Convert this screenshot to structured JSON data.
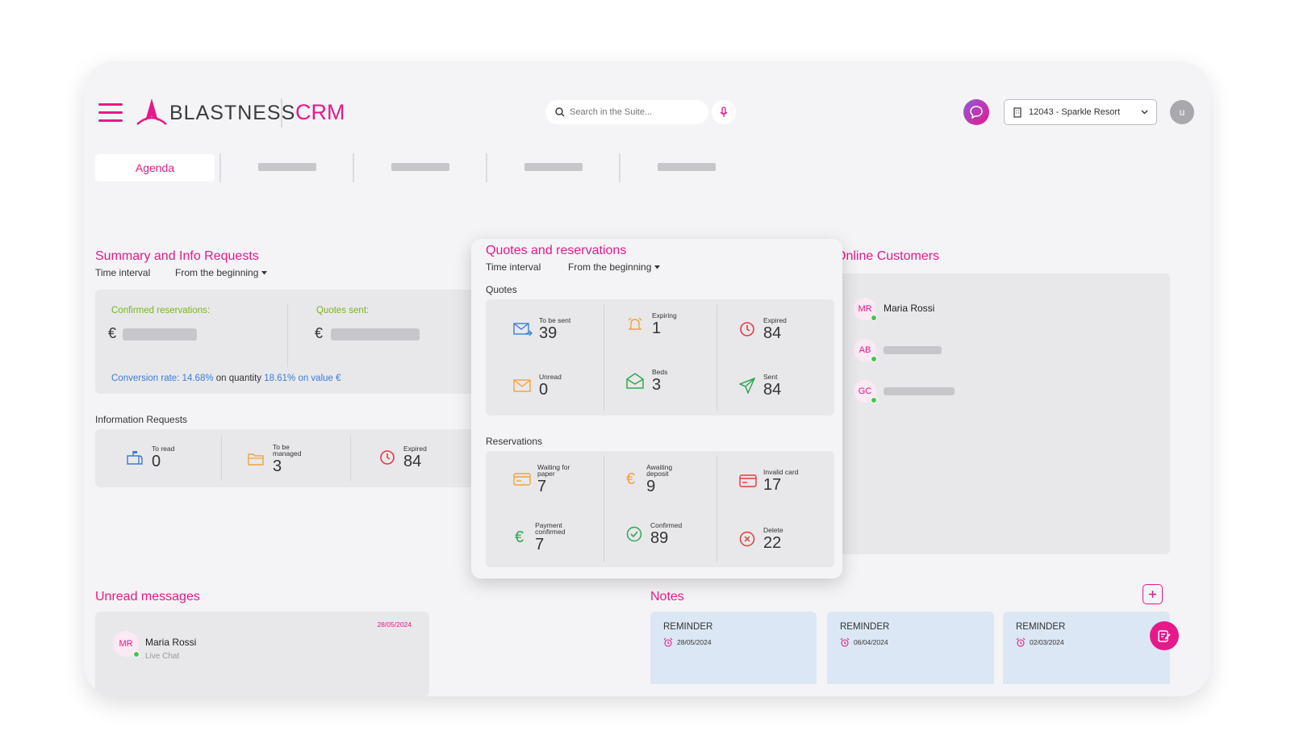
{
  "header": {
    "brand": "BLASTNESS",
    "product": "CRM",
    "search_placeholder": "Search in the Suite...",
    "property": "12043 - Sparkle Resort",
    "user_initial": "u"
  },
  "tabs": {
    "active": "Agenda"
  },
  "summary": {
    "title": "Summary and Info Requests",
    "interval_label": "Time interval",
    "interval_value": "From the beginning",
    "confirmed_label": "Confirmed reservations:",
    "quotes_sent_label": "Quotes sent:",
    "currency": "€",
    "conversion_prefix": "Conversion rate: 14.68%",
    "conversion_mid": "on quantity",
    "conversion_suffix": "18.61% on value €"
  },
  "info_requests": {
    "title": "Information Requests",
    "items": [
      {
        "label": "To read",
        "value": "0"
      },
      {
        "label": "To be managed",
        "value": "3"
      },
      {
        "label": "Expired",
        "value": "84"
      }
    ]
  },
  "quotes_reservations": {
    "title": "Quotes and reservations",
    "interval_label": "Time interval",
    "interval_value": "From the beginning",
    "quotes_title": "Quotes",
    "quotes": [
      {
        "label": "To be sent",
        "value": "39"
      },
      {
        "label": "Expiring",
        "value": "1"
      },
      {
        "label": "Expired",
        "value": "84"
      },
      {
        "label": "Unread",
        "value": "0"
      },
      {
        "label": "Beds",
        "value": "3"
      },
      {
        "label": "Sent",
        "value": "84"
      }
    ],
    "reservations_title": "Reservations",
    "reservations": [
      {
        "label": "Waiting for paper",
        "value": "7"
      },
      {
        "label": "Awaiting deposit",
        "value": "9"
      },
      {
        "label": "Invalid card",
        "value": "17"
      },
      {
        "label": "Payment confirmed",
        "value": "7"
      },
      {
        "label": "Confirmed",
        "value": "89"
      },
      {
        "label": "Delete",
        "value": "22"
      }
    ]
  },
  "online_customers": {
    "title": "Online Customers",
    "customers": [
      {
        "initials": "MR",
        "name": "Maria Rossi"
      },
      {
        "initials": "AB",
        "name": ""
      },
      {
        "initials": "GC",
        "name": ""
      }
    ]
  },
  "unread_messages": {
    "title": "Unread messages",
    "message": {
      "initials": "MR",
      "name": "Maria Rossi",
      "source": "Live Chat",
      "date": "28/05/2024"
    }
  },
  "notes": {
    "title": "Notes",
    "items": [
      {
        "title": "REMINDER",
        "date": "28/05/2024"
      },
      {
        "title": "REMINDER",
        "date": "06/04/2024"
      },
      {
        "title": "REMINDER",
        "date": "02/03/2024"
      }
    ]
  },
  "colors": {
    "accent": "#e6198a",
    "green": "#7cb518",
    "blue": "#3a7bd5",
    "orange": "#f2a33a",
    "red": "#e23b3b"
  }
}
